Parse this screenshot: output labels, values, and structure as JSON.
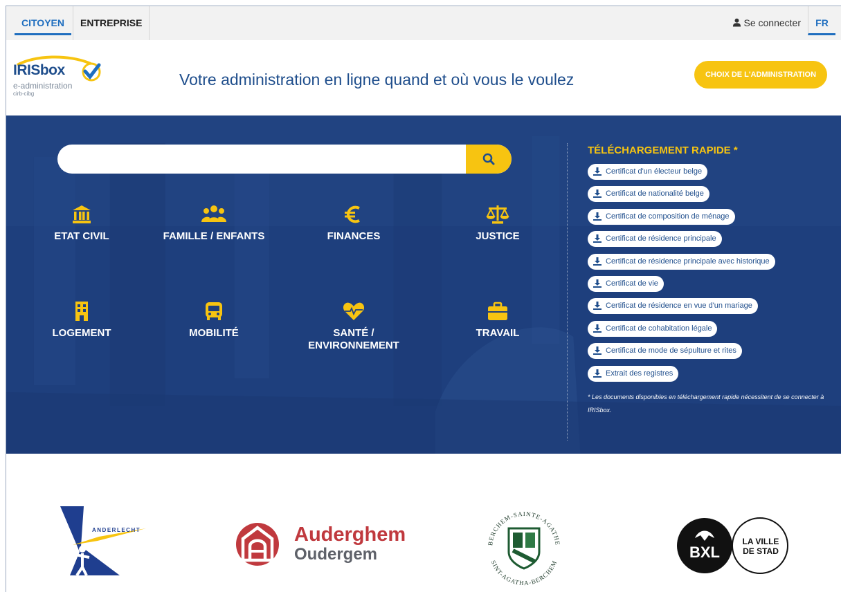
{
  "topbar": {
    "tab_citoyen": "CITOYEN",
    "tab_entreprise": "ENTREPRISE",
    "login": "Se connecter",
    "lang": "FR"
  },
  "header": {
    "logo_name": "IRISbox",
    "logo_sub": "e-administration",
    "logo_sub2": "cirb-cibg",
    "tagline": "Votre administration en ligne quand et où vous le voulez",
    "choice_button": "CHOIX DE L'ADMINISTRATION"
  },
  "search": {
    "placeholder": ""
  },
  "categories": [
    {
      "label": "ETAT CIVIL",
      "icon": "bank-icon"
    },
    {
      "label": "FAMILLE / ENFANTS",
      "icon": "users-icon"
    },
    {
      "label": "FINANCES",
      "icon": "euro-icon"
    },
    {
      "label": "JUSTICE",
      "icon": "scale-icon"
    },
    {
      "label": "LOGEMENT",
      "icon": "building-icon"
    },
    {
      "label": "MOBILITÉ",
      "icon": "bus-icon"
    },
    {
      "label": "SANTÉ / ENVIRONNEMENT",
      "icon": "heartbeat-icon"
    },
    {
      "label": "TRAVAIL",
      "icon": "briefcase-icon"
    }
  ],
  "downloads": {
    "title": "TÉLÉCHARGEMENT RAPIDE *",
    "items": [
      "Certificat d'un électeur belge",
      "Certificat de nationalité belge",
      "Certificat de composition de ménage",
      "Certificat de résidence principale",
      "Certificat de résidence principale avec historique",
      "Certificat de vie",
      "Certificat de résidence en vue d'un mariage",
      "Certificat de cohabitation légale",
      "Certificat de mode de sépulture et rites",
      "Extrait des registres"
    ],
    "note": "* Les documents disponibles en téléchargement rapide nécessitent de se connecter à IRISbox."
  },
  "communes": {
    "anderlecht": "ANDERLECHT",
    "auderghem_line1": "Auderghem",
    "auderghem_line2": "Oudergem",
    "berchem_top": "BERCHEM-SAINTE-AGATHE",
    "berchem_bottom": "SINT-AGATHA-BERCHEM",
    "bxl": "BXL",
    "bxl_line1": "LA VILLE",
    "bxl_line2": "DE STAD"
  },
  "colors": {
    "accent_yellow": "#f7c411",
    "hero_blue": "#1e3f7d",
    "link_blue": "#1f6ebf",
    "auderghem_red": "#c0393e"
  }
}
